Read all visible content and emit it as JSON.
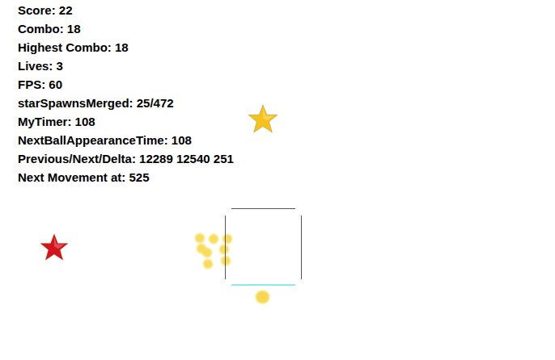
{
  "hud": {
    "lines": [
      "Score: 22",
      "Combo: 18",
      "Highest Combo: 18",
      "Lives: 3",
      "FPS: 60",
      "starSpawnsMerged: 25/472",
      "MyTimer: 108",
      "NextBallAppearanceTime: 108",
      "Previous/Next/Delta: 12289 12540 251",
      "Next Movement at: 525"
    ]
  },
  "stars": [
    {
      "name": "gold-star",
      "color": "#f5c21b"
    },
    {
      "name": "red-star",
      "color": "#d3141c"
    }
  ]
}
